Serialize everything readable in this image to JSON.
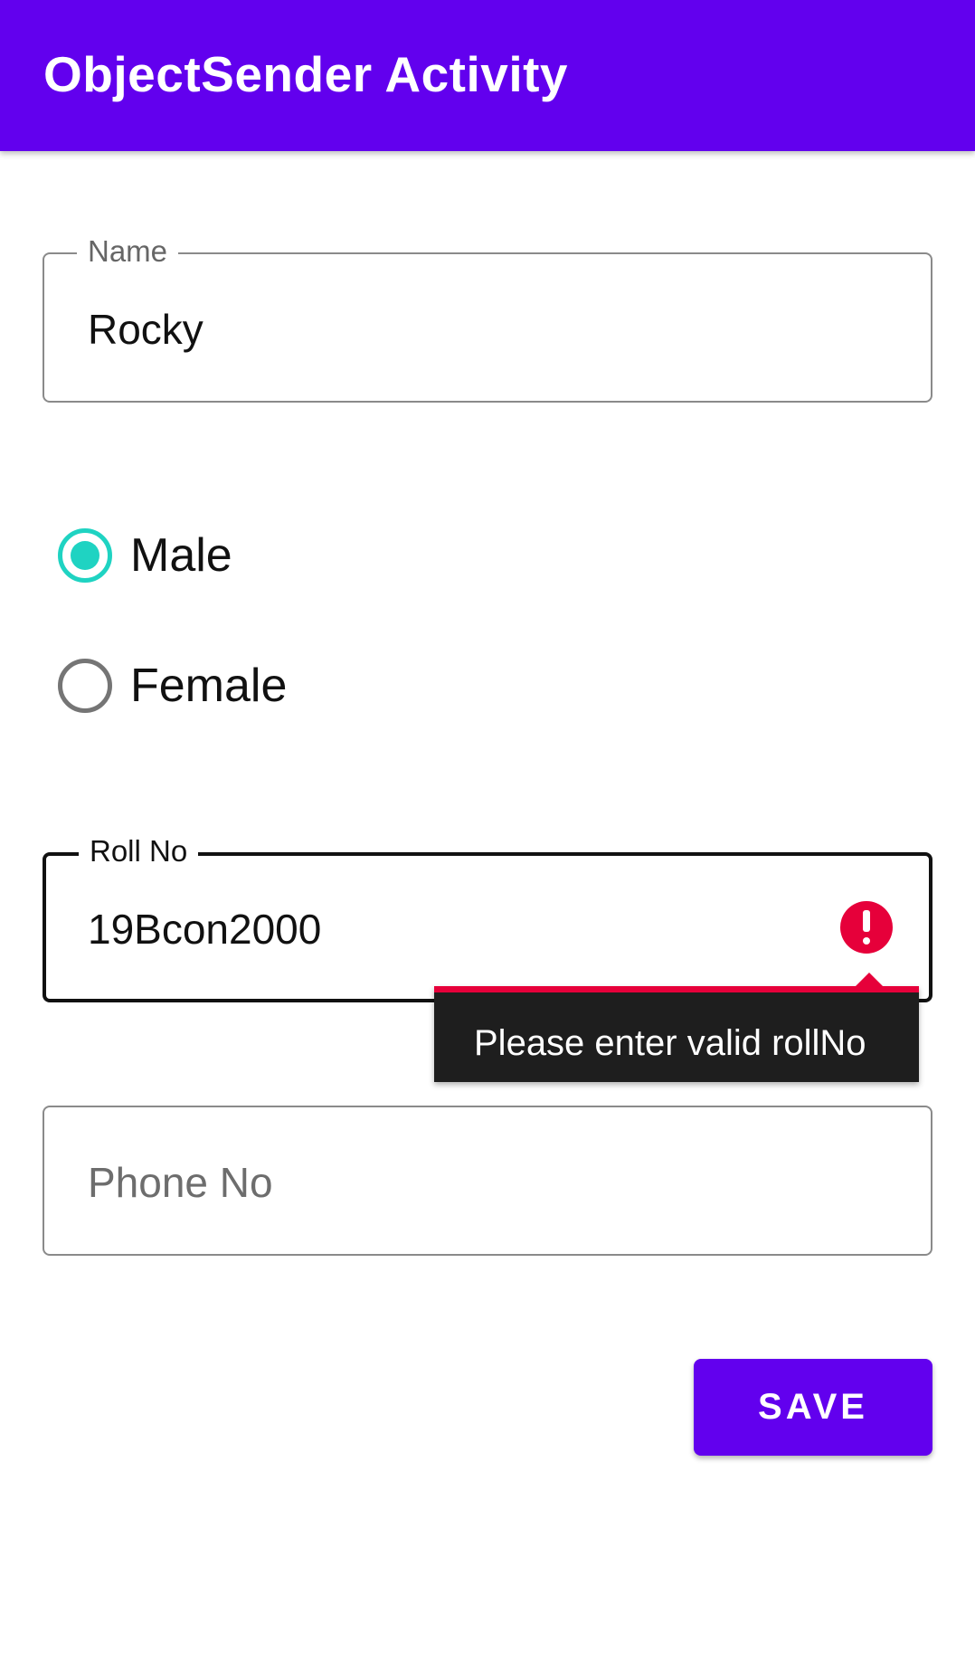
{
  "app_bar": {
    "title": "ObjectSender Activity",
    "color": "#6200ee"
  },
  "form": {
    "name_field": {
      "label": "Name",
      "value": "Rocky"
    },
    "gender": {
      "options": [
        {
          "label": "Male",
          "selected": true
        },
        {
          "label": "Female",
          "selected": false
        }
      ],
      "accent_color": "#1fd3c2"
    },
    "roll_field": {
      "label": "Roll No",
      "value": "19Bcon2000",
      "error_message": "Please enter valid rollNo",
      "error_color": "#e6003a"
    },
    "phone_field": {
      "placeholder": "Phone No",
      "value": ""
    },
    "save_label": "SAVE"
  }
}
